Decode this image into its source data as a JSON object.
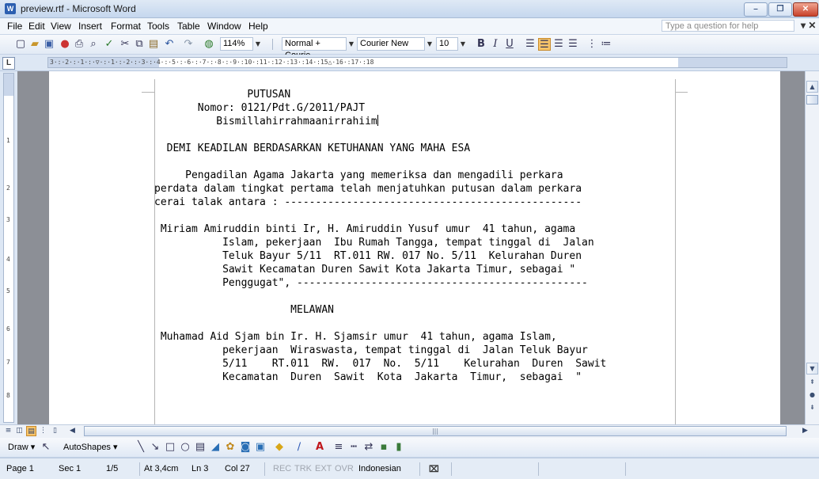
{
  "window": {
    "title": "preview.rtf - Microsoft Word"
  },
  "menu": {
    "items": [
      "File",
      "Edit",
      "View",
      "Insert",
      "Format",
      "Tools",
      "Table",
      "Window",
      "Help"
    ],
    "help_placeholder": "Type a question for help"
  },
  "toolbar": {
    "zoom": "114%",
    "style": "Normal + Courie",
    "font": "Courier New",
    "size": "10",
    "bold": "B",
    "italic": "I",
    "underline": "U"
  },
  "document": {
    "lines": [
      "               PUTUSAN",
      "       Nomor: 0121/Pdt.G/2011/PAJT",
      "          Bismillahirrahmaanirrahiim",
      "",
      "  DEMI KEADILAN BERDASARKAN KETUHANAN YANG MAHA ESA",
      "",
      "     Pengadilan Agama Jakarta yang memeriksa dan mengadili perkara",
      "perdata dalam tingkat pertama telah menjatuhkan putusan dalam perkara",
      "cerai talak antara : ------------------------------------------------",
      "",
      " Miriam Amiruddin binti Ir, H. Amiruddin Yusuf umur  41 tahun, agama",
      "           Islam, pekerjaan  Ibu Rumah Tangga, tempat tinggal di  Jalan",
      "           Teluk Bayur 5/11  RT.011 RW. 017 No. 5/11  Kelurahan Duren",
      "           Sawit Kecamatan Duren Sawit Kota Jakarta Timur, sebagai \"",
      "           Penggugat\", -----------------------------------------------",
      "",
      "                      MELAWAN",
      "",
      " Muhamad Aid Sjam bin Ir. H. Sjamsir umur  41 tahun, agama Islam,",
      "           pekerjaan  Wiraswasta, tempat tinggal di  Jalan Teluk Bayur",
      "           5/11    RT.011  RW.  017  No.  5/11    Kelurahan  Duren  Sawit",
      "           Kecamatan  Duren  Sawit  Kota  Jakarta  Timur,  sebagai  \""
    ]
  },
  "drawbar": {
    "draw": "Draw",
    "autoshapes": "AutoShapes"
  },
  "status": {
    "page": "Page 1",
    "sec": "Sec 1",
    "pages": "1/5",
    "at": "At 3,4cm",
    "ln": "Ln 3",
    "col": "Col 27",
    "rec": "REC",
    "trk": "TRK",
    "ext": "EXT",
    "ovr": "OVR",
    "language": "Indonesian"
  }
}
